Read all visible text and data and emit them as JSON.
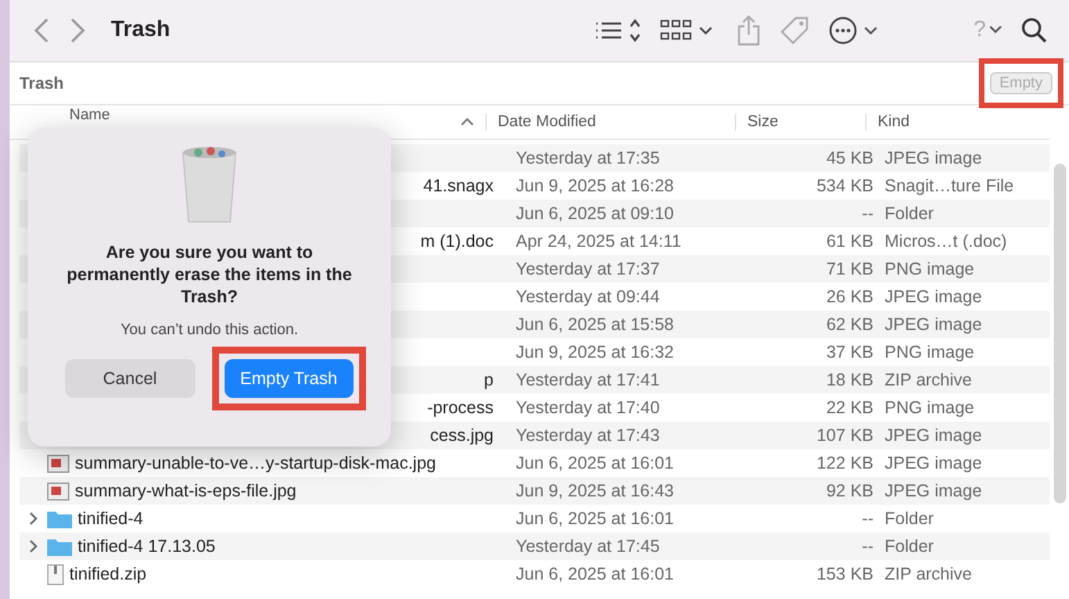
{
  "toolbar": {
    "title": "Trash",
    "help_label": "?"
  },
  "path_bar": {
    "title": "Trash",
    "empty_button": {
      "label": "Empty",
      "disabled": true,
      "highlighted": true
    }
  },
  "table": {
    "columns": [
      "Name",
      "Date Modified",
      "Size",
      "Kind"
    ],
    "rows": [
      {
        "date": "Yesterday at 17:35",
        "size": "45 KB",
        "file_type": "JPEG image"
      },
      {
        "name": "41.snagx",
        "kind": "clipped",
        "date": "Jun 9, 2025 at 16:28",
        "size": "534 KB",
        "file_type": "Snagit…ture File"
      },
      {
        "date": "Jun 6, 2025 at 09:10",
        "size": "--",
        "file_type": "Folder"
      },
      {
        "name": "m (1).doc",
        "kind": "clipped",
        "date": "Apr 24, 2025 at 14:11",
        "size": "61 KB",
        "file_type": "Micros…t (.doc)"
      },
      {
        "date": "Yesterday at 17:37",
        "size": "71 KB",
        "file_type": "PNG image"
      },
      {
        "date": "Yesterday at 09:44",
        "size": "26 KB",
        "file_type": "JPEG image"
      },
      {
        "date": "Jun 6, 2025 at 15:58",
        "size": "62 KB",
        "file_type": "JPEG image"
      },
      {
        "date": "Jun 9, 2025 at 16:32",
        "size": "37 KB",
        "file_type": "PNG image"
      },
      {
        "name": "p",
        "kind": "clipped",
        "date": "Yesterday at 17:41",
        "size": "18 KB",
        "file_type": "ZIP archive"
      },
      {
        "name": "-process",
        "kind": "clipped",
        "date": "Yesterday at 17:40",
        "size": "22 KB",
        "file_type": "PNG image"
      },
      {
        "name": "cess.jpg",
        "kind": "clipped",
        "date": "Yesterday at 17:43",
        "size": "107 KB",
        "file_type": "JPEG image"
      },
      {
        "name": "summary-unable-to-ve…y-startup-disk-mac.jpg",
        "kind": "image",
        "date": "Jun 6, 2025 at 16:01",
        "size": "122 KB",
        "file_type": "JPEG image"
      },
      {
        "name": "summary-what-is-eps-file.jpg",
        "kind": "image",
        "date": "Jun 9, 2025 at 16:43",
        "size": "92 KB",
        "file_type": "JPEG image"
      },
      {
        "name": "tinified-4",
        "kind": "folder",
        "expanded": false,
        "date": "Jun 6, 2025 at 16:01",
        "size": "--",
        "file_type": "Folder"
      },
      {
        "name": "tinified-4 17.13.05",
        "kind": "folder",
        "expanded": false,
        "date": "Yesterday at 17:45",
        "size": "--",
        "file_type": "Folder"
      },
      {
        "name": "tinified.zip",
        "kind": "zip",
        "date": "Jun 6, 2025 at 16:01",
        "size": "153 KB",
        "file_type": "ZIP archive"
      }
    ]
  },
  "dialog": {
    "message": "Are you sure you want to permanently erase the items in the Trash?",
    "detail": "You can’t undo this action.",
    "buttons": [
      {
        "label": "Cancel",
        "kind": "secondary",
        "highlighted": false
      },
      {
        "label": "Empty Trash",
        "kind": "primary",
        "highlighted": true
      }
    ]
  }
}
